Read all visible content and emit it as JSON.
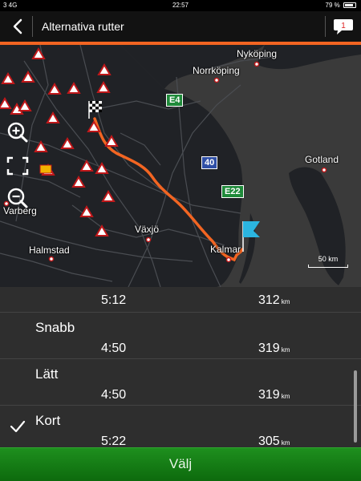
{
  "status_bar": {
    "carrier": "3 4G",
    "time": "22:57",
    "battery": "79 %",
    "battery_level": 0.79
  },
  "header": {
    "title": "Alternativa rutter",
    "message_count": "1"
  },
  "map": {
    "cities": {
      "nykoping": "Nyköping",
      "norrkoping": "Norrköping",
      "gotland": "Gotland",
      "varberg": "Varberg",
      "vaxjo": "Växjö",
      "halmstad": "Halmstad",
      "kalmar": "Kalmar"
    },
    "road_signs": {
      "e4": "E4",
      "r40": "40",
      "e22": "E22"
    },
    "scale_label": "50 km",
    "colors": {
      "route": "#f26522",
      "water": "#3a3a3a",
      "land": "#202226",
      "road": "#4a4d52"
    }
  },
  "routes": {
    "top": {
      "time": "5:12",
      "distance": "312",
      "unit": "km"
    },
    "items": [
      {
        "name": "Snabb",
        "time": "4:50",
        "distance": "319",
        "unit": "km"
      },
      {
        "name": "Lätt",
        "time": "4:50",
        "distance": "319",
        "unit": "km"
      },
      {
        "name": "Kort",
        "time": "5:22",
        "distance": "305",
        "unit": "km"
      }
    ]
  },
  "choose_button": {
    "label": "Välj"
  }
}
